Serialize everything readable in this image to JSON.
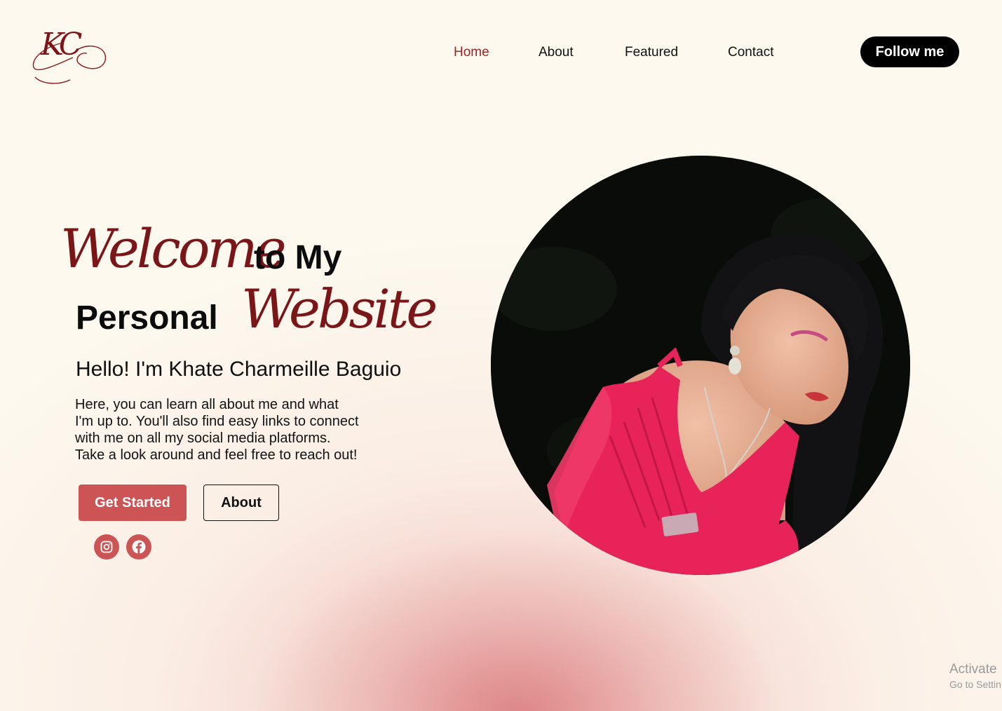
{
  "logo": {
    "text": "KC"
  },
  "nav": {
    "items": [
      {
        "label": "Home",
        "active": true
      },
      {
        "label": "About",
        "active": false
      },
      {
        "label": "Featured",
        "active": false
      },
      {
        "label": "Contact",
        "active": false
      }
    ],
    "follow_label": "Follow me"
  },
  "hero": {
    "script_welcome": "Welcome",
    "to_my": "to My",
    "personal": "Personal",
    "script_website": "Website",
    "greeting": "Hello! I'm Khate Charmeille Baguio",
    "intro": "Here, you can learn all about me and what\nI'm up to. You'll also find easy links to connect\nwith me on all my social media platforms.\nTake a look  around and feel free to reach out!",
    "get_started_label": "Get Started",
    "about_label": "About"
  },
  "social": [
    {
      "icon": "instagram-icon"
    },
    {
      "icon": "facebook-icon"
    }
  ],
  "watermark": {
    "line1": "Activate",
    "line2": "Go to Settin"
  },
  "colors": {
    "background": "#fdf9ef",
    "accent_red": "#cd5454",
    "script_maroon": "#7a1518",
    "nav_active": "#9b2424",
    "follow_bg": "#000000",
    "dress_pink": "#e8235a"
  }
}
